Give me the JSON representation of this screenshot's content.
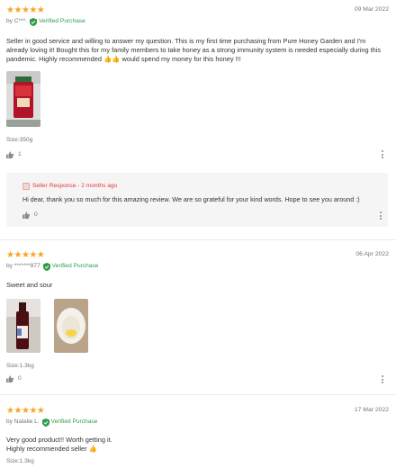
{
  "reviews": [
    {
      "stars": 5,
      "date": "09 Mar 2022",
      "author": "by C***.",
      "verified_label": "Verified Purchase",
      "text": "Seller in good service and willing to answer my question. This is my first time purchasing from Pure Honey Garden and I'm already loving it! Bought this for my family members to take honey as a strong immunity system is needed especially during this pandemic. Highly recommended 👍👍 would spend my money for this honey !!!",
      "size": "Size:350g",
      "likes": "1",
      "seller_reply": {
        "label": "Seller Response - 2 months ago",
        "text": "Hi dear, thank you so much for this amazing review. We are so grateful for your kind words. Hope to see you around :)",
        "likes": "0"
      }
    },
    {
      "stars": 5,
      "date": "06 Apr 2022",
      "author": "by *******877",
      "verified_label": "Verified Purchase",
      "text": "Sweet and sour",
      "size": "Size:1.3kg",
      "likes": "0"
    },
    {
      "stars": 5,
      "date": "17 Mar 2022",
      "author": "by Natalie L.",
      "verified_label": "Verified Purchase",
      "text_lines": [
        "Very good product!! Worth getting it.",
        "Highly recommended seller 👍"
      ],
      "size": "Size:1.3kg"
    }
  ],
  "colors": {
    "star": "#f6a623",
    "verified": "#2e9c4a",
    "seller": "#e53935"
  },
  "icons": {
    "star": "star-icon",
    "verified": "verified-shield-icon",
    "like": "thumbs-up-icon",
    "more": "more-vertical-icon",
    "seller": "seller-avatar-icon"
  }
}
